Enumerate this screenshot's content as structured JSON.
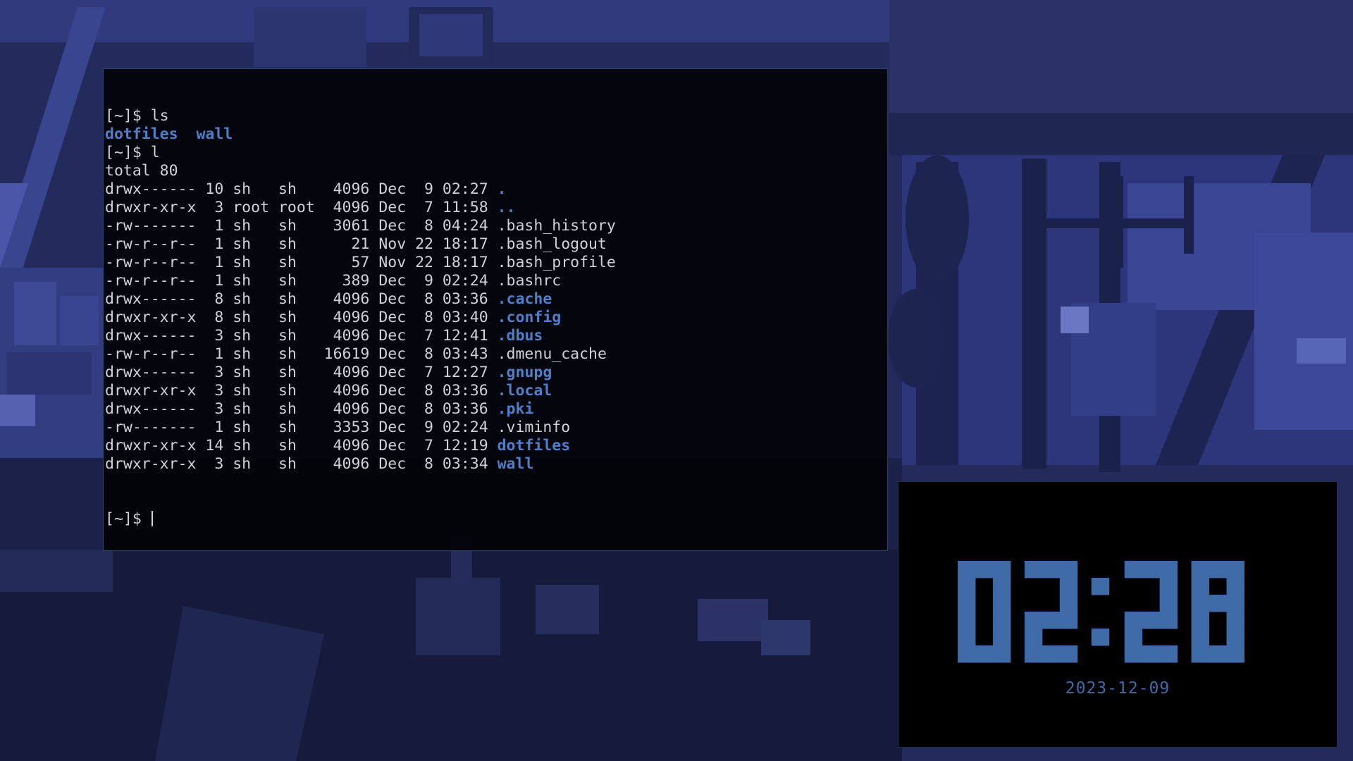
{
  "terminal": {
    "lines": [
      [
        {
          "t": "[~]$ ls",
          "c": ""
        }
      ],
      [
        {
          "t": "dotfiles",
          "c": "hl"
        },
        {
          "t": "  ",
          "c": ""
        },
        {
          "t": "wall",
          "c": "hl"
        }
      ],
      [
        {
          "t": "[~]$ l",
          "c": ""
        }
      ],
      [
        {
          "t": "total 80",
          "c": ""
        }
      ],
      [
        {
          "t": "drwx------ 10 sh   sh    4096 Dec  9 02:27 ",
          "c": ""
        },
        {
          "t": ".",
          "c": "hl"
        }
      ],
      [
        {
          "t": "drwxr-xr-x  3 root root  4096 Dec  7 11:58 ",
          "c": ""
        },
        {
          "t": "..",
          "c": "hl"
        }
      ],
      [
        {
          "t": "-rw-------  1 sh   sh    3061 Dec  8 04:24 .bash_history",
          "c": ""
        }
      ],
      [
        {
          "t": "-rw-r--r--  1 sh   sh      21 Nov 22 18:17 .bash_logout",
          "c": ""
        }
      ],
      [
        {
          "t": "-rw-r--r--  1 sh   sh      57 Nov 22 18:17 .bash_profile",
          "c": ""
        }
      ],
      [
        {
          "t": "-rw-r--r--  1 sh   sh     389 Dec  9 02:24 .bashrc",
          "c": ""
        }
      ],
      [
        {
          "t": "drwx------  8 sh   sh    4096 Dec  8 03:36 ",
          "c": ""
        },
        {
          "t": ".cache",
          "c": "hl"
        }
      ],
      [
        {
          "t": "drwxr-xr-x  8 sh   sh    4096 Dec  8 03:40 ",
          "c": ""
        },
        {
          "t": ".config",
          "c": "hl"
        }
      ],
      [
        {
          "t": "drwx------  3 sh   sh    4096 Dec  7 12:41 ",
          "c": ""
        },
        {
          "t": ".dbus",
          "c": "hl"
        }
      ],
      [
        {
          "t": "-rw-r--r--  1 sh   sh   16619 Dec  8 03:43 .dmenu_cache",
          "c": ""
        }
      ],
      [
        {
          "t": "drwx------  3 sh   sh    4096 Dec  7 12:27 ",
          "c": ""
        },
        {
          "t": ".gnupg",
          "c": "hl"
        }
      ],
      [
        {
          "t": "drwxr-xr-x  3 sh   sh    4096 Dec  8 03:36 ",
          "c": ""
        },
        {
          "t": ".local",
          "c": "hl"
        }
      ],
      [
        {
          "t": "drwx------  3 sh   sh    4096 Dec  8 03:36 ",
          "c": ""
        },
        {
          "t": ".pki",
          "c": "hl"
        }
      ],
      [
        {
          "t": "-rw-------  1 sh   sh    3353 Dec  9 02:24 .viminfo",
          "c": ""
        }
      ],
      [
        {
          "t": "drwxr-xr-x 14 sh   sh    4096 Dec  7 12:19 ",
          "c": ""
        },
        {
          "t": "dotfiles",
          "c": "hl"
        }
      ],
      [
        {
          "t": "drwxr-xr-x  3 sh   sh    4096 Dec  8 03:34 ",
          "c": ""
        },
        {
          "t": "wall",
          "c": "hl"
        }
      ]
    ],
    "prompt": "[~]$ "
  },
  "clock": {
    "time": "02:28",
    "date": "2023-12-09"
  },
  "colors": {
    "accent": "#3f6aa8",
    "highlight": "#4f7fc9",
    "terminal_text": "#cfd2d8",
    "terminal_bg": "#000000",
    "wallpaper": "#252d60"
  }
}
